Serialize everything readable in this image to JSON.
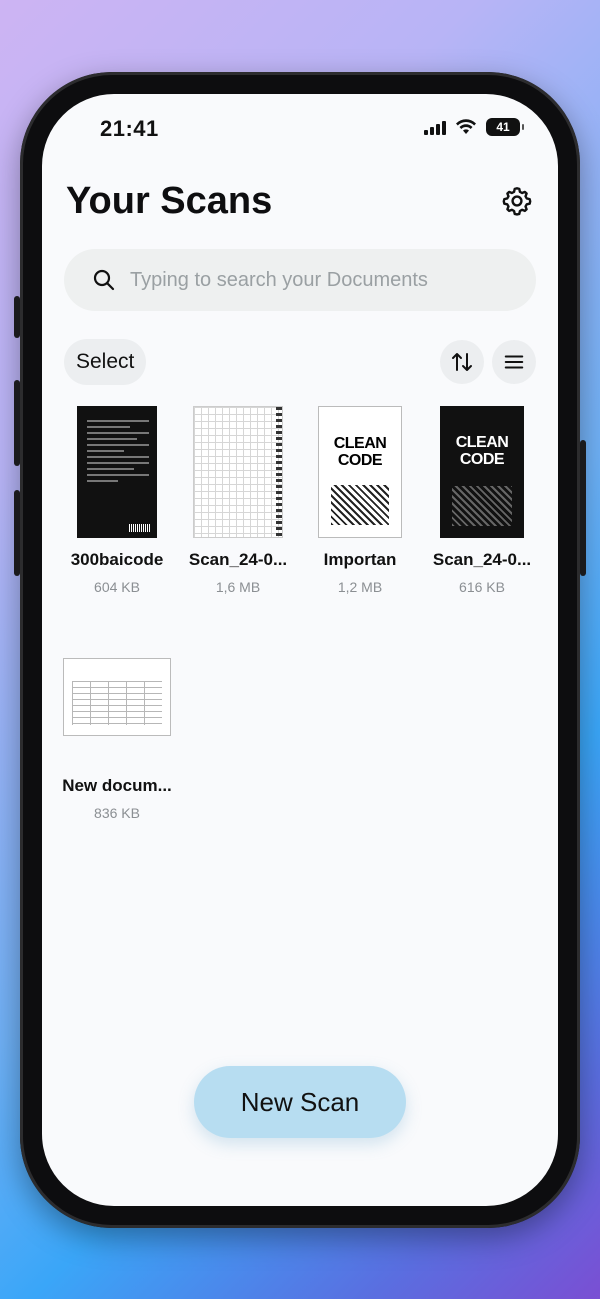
{
  "status": {
    "time": "21:41",
    "battery": "41"
  },
  "header": {
    "title": "Your Scans"
  },
  "search": {
    "placeholder": "Typing to search your Documents"
  },
  "toolbar": {
    "select_label": "Select"
  },
  "documents": [
    {
      "name": "300baicode",
      "size": "604 KB"
    },
    {
      "name": "Scan_24-0...",
      "size": "1,6 MB"
    },
    {
      "name": "Importan",
      "size": "1,2 MB",
      "cover_text": "CLEAN CODE"
    },
    {
      "name": "Scan_24-0...",
      "size": "616 KB",
      "cover_text": "CLEAN CODE"
    },
    {
      "name": "New docum...",
      "size": "836 KB"
    }
  ],
  "actions": {
    "new_scan_label": "New Scan"
  },
  "colors": {
    "accent": "#b7ddf1",
    "search_bg": "#eef0f0",
    "screen_bg": "#f9fafc"
  }
}
